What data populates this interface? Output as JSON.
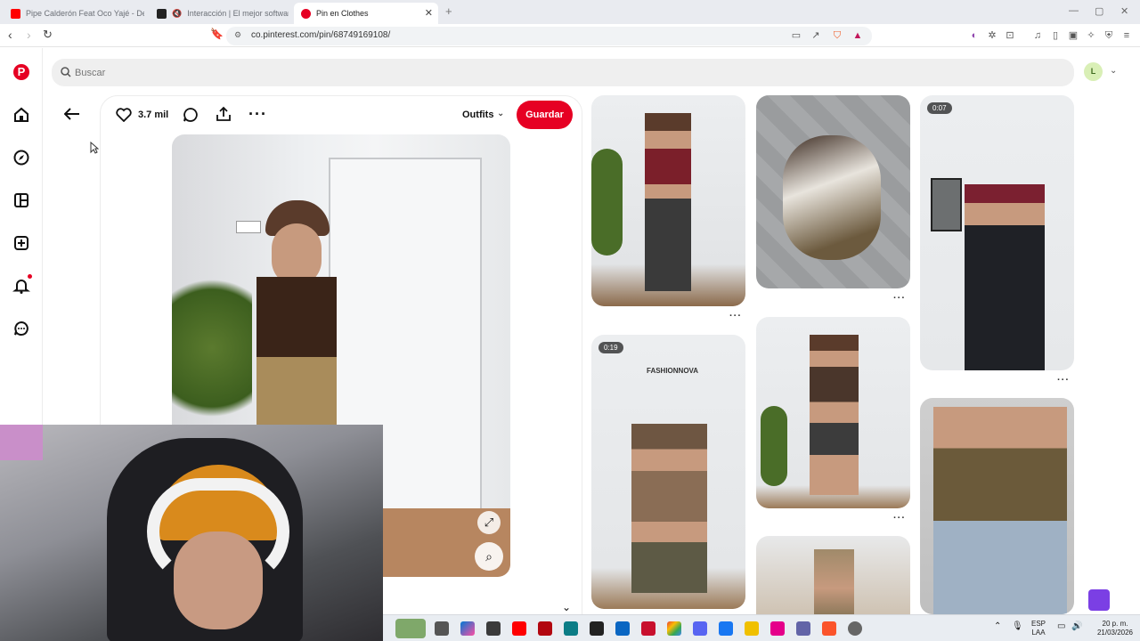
{
  "browser": {
    "tabs": [
      {
        "title": "Pipe Calderón Feat Oco Yajé - De Re",
        "color": "#ff0000"
      },
      {
        "title": "Interacción | El mejor software p",
        "color": "#222222"
      },
      {
        "title": "Pin en Clothes",
        "color": "#e60023"
      }
    ],
    "url": "co.pinterest.com/pin/68749169108/"
  },
  "search": {
    "placeholder": "Buscar"
  },
  "user": {
    "initial": "L"
  },
  "pin": {
    "likes": "3.7 mil",
    "board": "Outfits",
    "save_label": "Guardar"
  },
  "feed": {
    "durations": [
      "0:07",
      "0:19"
    ]
  },
  "overlay": {
    "fashion_nova": "FASHIONNOVA"
  },
  "system": {
    "lang1": "ESP",
    "lang2": "LAA",
    "time": "20 p. m.",
    "date": "21/03/2026"
  },
  "colors": {
    "brand": "#e60023"
  }
}
